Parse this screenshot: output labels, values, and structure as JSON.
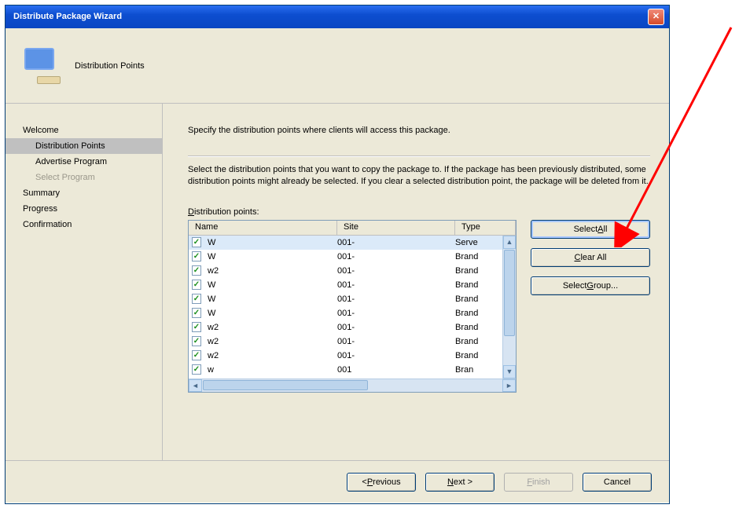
{
  "window": {
    "title": "Distribute Package Wizard"
  },
  "header": {
    "title": "Distribution Points"
  },
  "nav": {
    "items": [
      {
        "label": "Welcome",
        "sub": false,
        "selected": false,
        "disabled": false
      },
      {
        "label": "Distribution Points",
        "sub": true,
        "selected": true,
        "disabled": false
      },
      {
        "label": "Advertise Program",
        "sub": true,
        "selected": false,
        "disabled": false
      },
      {
        "label": "Select Program",
        "sub": true,
        "selected": false,
        "disabled": true
      },
      {
        "label": "Summary",
        "sub": false,
        "selected": false,
        "disabled": false
      },
      {
        "label": "Progress",
        "sub": false,
        "selected": false,
        "disabled": false
      },
      {
        "label": "Confirmation",
        "sub": false,
        "selected": false,
        "disabled": false
      }
    ]
  },
  "content": {
    "instruction": "Specify the distribution points where clients will access this package.",
    "description": "Select the distribution points that you want to copy the package to. If the package has been previously distributed, some distribution points might already be selected. If you clear a selected distribution point, the package will be deleted from it.",
    "list_label": "Distribution points:"
  },
  "table": {
    "columns": {
      "name": "Name",
      "site": "Site",
      "type": "Type"
    },
    "rows": [
      {
        "chk": true,
        "name": "W",
        "site": "001-",
        "type": "Serve",
        "selected": true
      },
      {
        "chk": true,
        "name": "W",
        "site": "001-",
        "type": "Brand"
      },
      {
        "chk": true,
        "name": "w2",
        "site": "001-",
        "type": "Brand"
      },
      {
        "chk": true,
        "name": "W",
        "site": "001-",
        "type": "Brand"
      },
      {
        "chk": true,
        "name": "W",
        "site": "001-",
        "type": "Brand"
      },
      {
        "chk": true,
        "name": "W",
        "site": "001-",
        "type": "Brand"
      },
      {
        "chk": true,
        "name": "w2",
        "site": "001-",
        "type": "Brand"
      },
      {
        "chk": true,
        "name": "w2",
        "site": "001-",
        "type": "Brand"
      },
      {
        "chk": true,
        "name": "w2",
        "site": "001-",
        "type": "Brand"
      },
      {
        "chk": true,
        "name": "w",
        "site": "001",
        "type": "Bran"
      }
    ]
  },
  "side_buttons": {
    "select_all": "Select All",
    "clear_all": "Clear All",
    "select_group": "Select Group..."
  },
  "footer": {
    "previous": "< Previous",
    "next": "Next >",
    "finish": "Finish",
    "cancel": "Cancel"
  }
}
